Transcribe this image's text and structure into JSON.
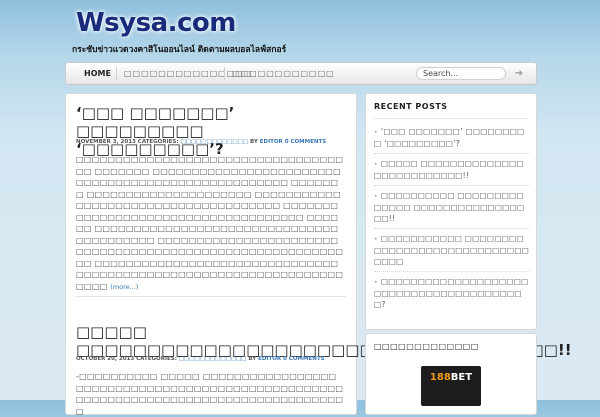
{
  "header": {
    "logo": "Wsysa.com",
    "tagline": "กระชับข่าวแวดวงคาสิโนออนไลน์ ติดตามผลบอลไลฟ์สกอร์"
  },
  "nav": {
    "items": [
      {
        "label": "HOME",
        "active": true
      },
      {
        "label": "□□□□□□□□□□□□□□□",
        "active": false
      },
      {
        "label": "□□□□□□□□□□□□",
        "active": false
      }
    ],
    "search_value": "Search...",
    "search_icon": "arrow-right-icon"
  },
  "posts": [
    {
      "title": "‘□□□ □□□□□□□’ □□□□□□□□□ ‘□□□□□□□□□’?",
      "date": "NOVEMBER 3, 2013",
      "categories_label": "CATEGORIES:",
      "category": "□□□□□□□□□□□□□",
      "by_label": "BY",
      "author": "EDITOR",
      "comments": "0 COMMENTS",
      "excerpt": "□□□□□□□□□□□□□□□□□□□□□□□□□□□□□□□□□□□□ □□□□□□□ □□□□□□□□□□□□□□□□□□□□□□□□□□□□□□□□□□□□□□□□□□□□□□□□□□□ □□□□□□□ □□□□□□□□□□□□□□□□□□□□□ □□□□□□□□□□□□□□□□□□□□□□□□□□□□□□□□□□□□□ □□□□□□□□□□□□□□□□□□□□□□□□□□□□□□□□□□□□ □□□□□□ □□□□□□□□□□□□□□□□□□□□□□□□□□□□□□□□□□□□□□□□□ □□□□□□□□□□□□□□□□□□□□□□□□□□□□□□□□□□□□□□□□□□□□□□□□□□□□□□□□□□□ □□□□□□□□□□□□□□□□□□□□□□□□□□□□□□□□□□□□□□□□□□□□□□□□□□□□□□□□□□□□□□□□□□□□□",
      "more": "(more...)"
    },
    {
      "title": "□□□□□ □□□□□□□□□□□□□□□□□□□□□□□□□□□□□□□□□□!!",
      "date": "OCTOBER 20, 2013",
      "categories_label": "CATEGORIES:",
      "category": "□□□□□□□□□□□□□",
      "by_label": "BY",
      "author": "EDITOR",
      "comments": "0 COMMENTS",
      "excerpt": "-□□□□□□□□□□ □□□□□ □□□□□□□□□□□□□□□□□□□□□□□□□□□□□□□□□□□□□□□□□□□□□□□□□□□□□□□□□□□□□□□□□□□□□□□□□□□□□□□□□□□□□□",
      "more": ""
    }
  ],
  "sidebar": {
    "recent_posts_title": "RECENT POSTS",
    "recent_posts": [
      "‘□□□ □□□□□□□’ □□□□□□□□□ ‘□□□□□□□□□’?",
      "□□□□□ □□□□□□□□□□□□□□□□□□□□□□□□□□!!",
      "□□□□□□□□□□ □□□□□□□□□□□□□□ □□□□□□□□□□□□□□□□□!!",
      "□□□□□□□□□□□ □□□□□□□□□□□□□□□□□□□□□□□□□□□□□□□□□",
      "□□□□□□□□□□□□□□□□□□□□□□□□□□□□□□□□□□□□□□□□□?"
    ],
    "widget2_title": "□□□□□□□□□□□□□",
    "banner_part1": "188",
    "banner_part2": "BET"
  },
  "colors": {
    "link": "#3a76b5",
    "logo": "#1a2a7a",
    "banner_bg": "#1d1d1d",
    "banner_accent": "#f39a1e"
  }
}
